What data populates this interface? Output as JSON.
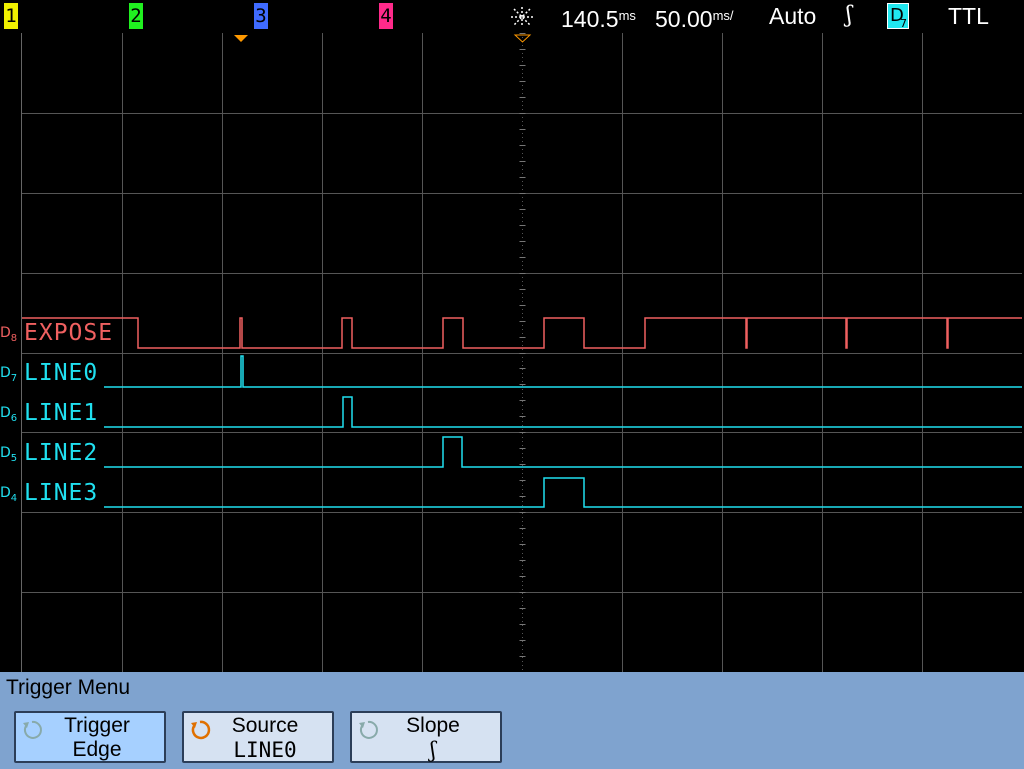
{
  "status": {
    "channels": [
      {
        "label": "1",
        "color": "#f0f000"
      },
      {
        "label": "2",
        "color": "#20f020"
      },
      {
        "label": "3",
        "color": "#3f6bff"
      },
      {
        "label": "4",
        "color": "#ff2a8a"
      }
    ],
    "icon": "run-status-icon",
    "delay": "140.5",
    "delay_unit": "ms",
    "timebase": "50.00",
    "timebase_unit": "ms/",
    "trigger_mode": "Auto",
    "trigger_slope_symbol": "ʃ",
    "trigger_source": "D",
    "trigger_source_sub": "7",
    "trigger_level": "TTL"
  },
  "channels": [
    {
      "id": "D",
      "sub": "8",
      "name": "EXPOSE",
      "color": "#f06060"
    },
    {
      "id": "D",
      "sub": "7",
      "name": "LINE0",
      "color": "#20e0f0"
    },
    {
      "id": "D",
      "sub": "6",
      "name": "LINE1",
      "color": "#20e0f0"
    },
    {
      "id": "D",
      "sub": "5",
      "name": "LINE2",
      "color": "#20e0f0"
    },
    {
      "id": "D",
      "sub": "4",
      "name": "LINE3",
      "color": "#20e0f0"
    }
  ],
  "menu": {
    "title": "Trigger Menu",
    "softkeys": [
      {
        "label": "Trigger",
        "value": "Edge",
        "icon": "rotate-knob-icon"
      },
      {
        "label": "Source",
        "value": "LINE0",
        "icon": "rotate-knob-icon"
      },
      {
        "label": "Slope",
        "value": "ʃ",
        "icon": "rotate-knob-icon"
      }
    ]
  },
  "colors": {
    "grid": "#555555",
    "menu_bg": "#7fa3cf",
    "trigger_marker": "#ff9900"
  }
}
